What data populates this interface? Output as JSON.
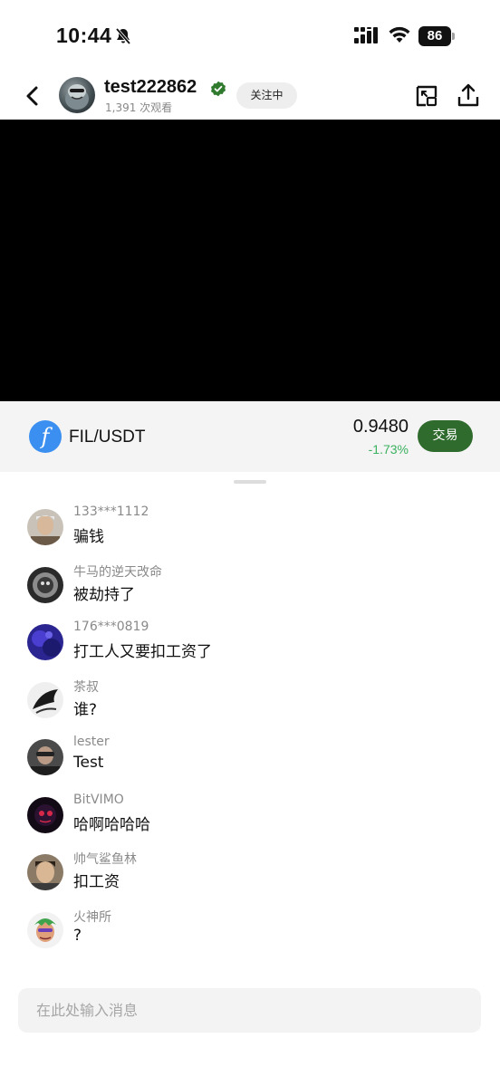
{
  "status_bar": {
    "time": "10:44",
    "battery": "86"
  },
  "header": {
    "username": "test222862",
    "viewers": "1,391 次观看",
    "follow_label": "关注中"
  },
  "ticker": {
    "coin_symbol": "f",
    "pair": "FIL/USDT",
    "price": "0.9480",
    "change": "-1.73%",
    "change_color": "#3bb15f",
    "trade_label": "交易",
    "trade_color": "#2f6b2c"
  },
  "chat": {
    "messages": [
      {
        "name": "133***1112",
        "text": "骗钱"
      },
      {
        "name": "牛马的逆天改命",
        "text": "被劫持了"
      },
      {
        "name": "176***0819",
        "text": "打工人又要扣工资了"
      },
      {
        "name": "茶叔",
        "text": "谁?"
      },
      {
        "name": "lester",
        "text": "Test"
      },
      {
        "name": "BitVIMO",
        "text": "哈啊哈哈哈"
      },
      {
        "name": "帅气鲨鱼林",
        "text": "扣工资"
      },
      {
        "name": "火神所",
        "text": "?"
      }
    ]
  },
  "input": {
    "placeholder": "在此处输入消息"
  }
}
